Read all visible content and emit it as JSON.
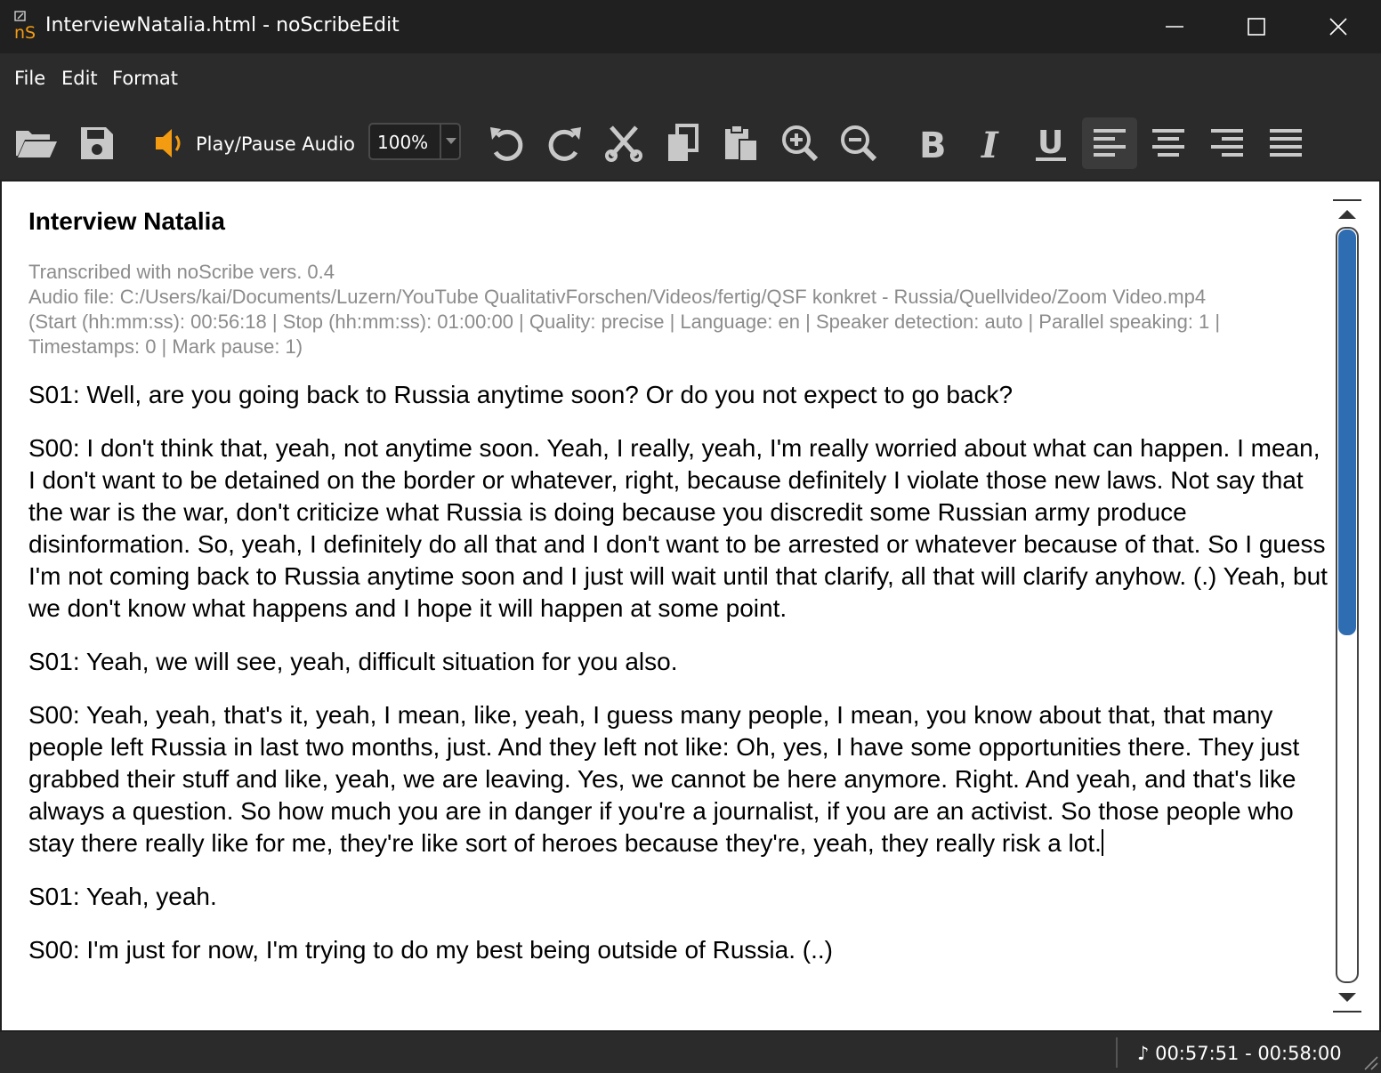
{
  "window": {
    "title": "InterviewNatalia.html - noScribeEdit",
    "logo_text": "nS"
  },
  "menu": {
    "items": [
      "File",
      "Edit",
      "Format"
    ]
  },
  "toolbar": {
    "open_icon": "folder-open-icon",
    "save_icon": "save-icon",
    "play_label": "Play/Pause Audio",
    "zoom_value": "100%",
    "tools": [
      "undo-icon",
      "redo-icon",
      "cut-icon",
      "copy-icon",
      "paste-icon",
      "zoom-in-icon",
      "zoom-out-icon",
      "bold-icon",
      "italic-icon",
      "underline-icon",
      "align-left-icon",
      "align-center-icon",
      "align-right-icon",
      "justify-icon"
    ],
    "active_tool": "align-left-icon"
  },
  "document": {
    "title": "Interview Natalia",
    "meta": [
      "Transcribed with noScribe vers. 0.4",
      "Audio file: C:/Users/kai/Documents/Luzern/YouTube QualitativForschen/Videos/fertig/QSF konkret - Russia/Quellvideo/Zoom Video.mp4",
      "(Start (hh:mm:ss): 00:56:18 | Stop (hh:mm:ss): 01:00:00 | Quality: precise | Language: en | Speaker detection: auto | Parallel speaking: 1 | Timestamps: 0 | Mark pause: 1)"
    ],
    "paragraphs": [
      "S01: Well, are you going back to Russia anytime soon? Or do you not expect to go back?",
      "S00: I don't think that, yeah, not anytime soon. Yeah, I really, yeah, I'm really worried about what can happen. I mean, I don't want to be detained on the border or whatever, right, because definitely I violate those new laws. Not say that the war is the war, don't criticize what Russia is doing because you discredit some Russian army produce disinformation. So, yeah, I definitely do all that and I don't want to be arrested or whatever because of that. So I guess I'm not coming back to Russia anytime soon and I just will wait until that clarify, all that will clarify anyhow. (.) Yeah, but we don't know what happens and I hope it will happen at some point.",
      "S01: Yeah, we will see, yeah, difficult situation for you also.",
      "S00: Yeah, yeah, that's it, yeah, I mean, like, yeah, I guess many people, I mean, you know about that, that many people left Russia in last two months, just. And they left not like: Oh, yes, I have some opportunities there. They just grabbed their stuff and like, yeah, we are leaving. Yes, we cannot be here anymore. Right. And yeah, and that's like always a question. So how much you are in danger if you're a journalist, if you are an activist. So those people who stay there really like for me, they're like sort of heroes because they're, yeah, they really risk a lot.",
      "S01: Yeah, yeah.",
      "S00: I'm just for now, I'm trying to do my best being outside of Russia. (..)"
    ]
  },
  "status": {
    "time_range": "♪ 00:57:51 - 00:58:00"
  },
  "colors": {
    "titlebar": "#202020",
    "toolbar": "#2b2b2b",
    "accent_orange": "#f39c12",
    "scroll_thumb": "#2f6db3",
    "meta_text": "#8c8c8c"
  }
}
